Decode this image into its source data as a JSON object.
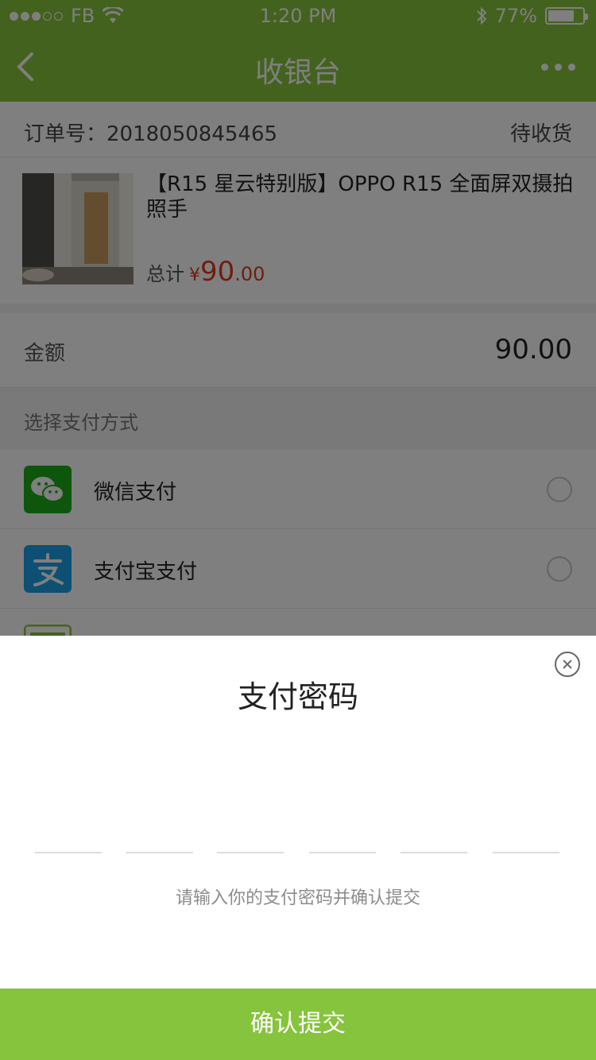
{
  "status_bar": {
    "carrier": "FB",
    "time": "1:20 PM",
    "battery": "77%",
    "battery_level": 0.77
  },
  "nav": {
    "title": "收银台"
  },
  "order": {
    "label_number": "订单号：2018050845465",
    "status": "待收货"
  },
  "product": {
    "name": "【R15 星云特别版】OPPO R15 全面屏双摄拍照手",
    "total_label": "总计",
    "currency": "¥",
    "price_int": "90",
    "price_dec": ".00"
  },
  "amount": {
    "label": "金额",
    "value": "90.00"
  },
  "payment": {
    "section_title": "选择支付方式",
    "methods": [
      {
        "label": "微信支付",
        "icon": "wechat-pay-icon",
        "color": "#1aad19"
      },
      {
        "label": "支付宝支付",
        "icon": "alipay-icon",
        "color": "#1aa0e6"
      }
    ]
  },
  "password_sheet": {
    "title": "支付密码",
    "hint": "请输入你的支付密码并确认提交",
    "confirm_label": "确认提交",
    "digits": 6
  },
  "colors": {
    "brand_green": "#86c43d",
    "price_red": "#e03a1a"
  }
}
